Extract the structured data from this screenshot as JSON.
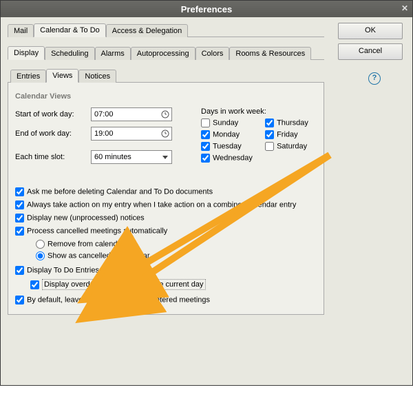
{
  "window_title": "Preferences",
  "buttons": {
    "ok": "OK",
    "cancel": "Cancel"
  },
  "tabs_top": {
    "mail": "Mail",
    "caltodo": "Calendar & To Do",
    "access": "Access & Delegation"
  },
  "tabs_sub": {
    "display": "Display",
    "scheduling": "Scheduling",
    "alarms": "Alarms",
    "autoprocessing": "Autoprocessing",
    "colors": "Colors",
    "rooms": "Rooms & Resources"
  },
  "tabs_subsub": {
    "entries": "Entries",
    "views": "Views",
    "notices": "Notices"
  },
  "section_title": "Calendar Views",
  "fields": {
    "start_label": "Start of work day:",
    "start_value": "07:00",
    "end_label": "End of work day:",
    "end_value": "19:00",
    "slot_label": "Each time slot:",
    "slot_value": "60 minutes"
  },
  "days_header": "Days in work week:",
  "days": {
    "sunday": "Sunday",
    "monday": "Monday",
    "tuesday": "Tuesday",
    "wednesday": "Wednesday",
    "thursday": "Thursday",
    "friday": "Friday",
    "saturday": "Saturday"
  },
  "days_checked": {
    "sunday": false,
    "monday": true,
    "tuesday": true,
    "wednesday": true,
    "thursday": true,
    "friday": true,
    "saturday": false
  },
  "opts": {
    "ask_delete": "Ask me before deleting Calendar and To Do documents",
    "always_action": "Always take action on my entry when I take action on a combined calendar entry",
    "display_new": "Display new (unprocessed) notices",
    "process_cancelled": "Process cancelled meetings automatically",
    "remove_cal": "Remove from calendar",
    "show_cancelled": "Show as cancelled in calendar",
    "display_todo": "Display To Do Entries",
    "overdue": "Display overdue To Do items on the current day",
    "placeholder": "By default, leave a placeholder for countered meetings"
  },
  "colors": {
    "arrow": "#f5a623"
  }
}
